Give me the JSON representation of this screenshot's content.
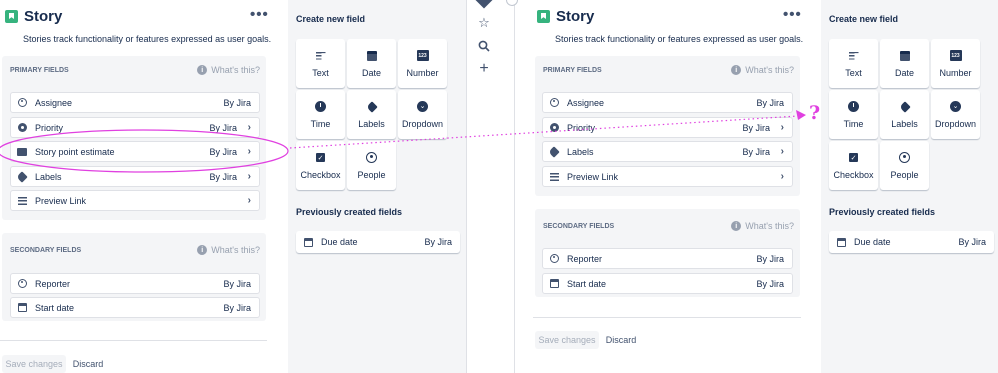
{
  "left": {
    "title": "Story",
    "more_label": "•••",
    "description": "Stories track functionality or features expressed as user goals.",
    "primary_header": "PRIMARY FIELDS",
    "whats_this": "What's this?",
    "primary_rows": [
      {
        "label": "Assignee",
        "by": "By Jira",
        "icon": "user-icon"
      },
      {
        "label": "Priority",
        "by": "By Jira",
        "icon": "priority-icon",
        "chev": "›"
      },
      {
        "label": "Story point estimate",
        "by": "By Jira",
        "icon": "number-icon",
        "chev": "›"
      },
      {
        "label": "Labels",
        "by": "By Jira",
        "icon": "label-icon",
        "chev": "›"
      },
      {
        "label": "Preview Link",
        "by": "",
        "icon": "paragraph-icon",
        "chev": "›"
      }
    ],
    "secondary_header": "SECONDARY FIELDS",
    "secondary_rows": [
      {
        "label": "Reporter",
        "by": "By Jira",
        "icon": "user-icon"
      },
      {
        "label": "Start date",
        "by": "By Jira",
        "icon": "calendar-icon"
      }
    ],
    "save": "Save changes",
    "discard": "Discard"
  },
  "create": {
    "header": "Create new field",
    "tiles": [
      "Text",
      "Date",
      "Number",
      "Time",
      "Labels",
      "Dropdown",
      "Checkbox",
      "People"
    ],
    "number_glyph": "123",
    "previous_header": "Previously created fields",
    "previous_rows": [
      {
        "label": "Due date",
        "by": "By Jira"
      }
    ]
  },
  "right": {
    "title": "Story",
    "more_label": "•••",
    "description": "Stories track functionality or features expressed as user goals.",
    "primary_header": "PRIMARY FIELDS",
    "whats_this": "What's this?",
    "primary_rows": [
      {
        "label": "Assignee",
        "by": "By Jira",
        "icon": "user-icon"
      },
      {
        "label": "Priority",
        "by": "By Jira",
        "icon": "priority-icon",
        "chev": "›"
      },
      {
        "label": "Labels",
        "by": "By Jira",
        "icon": "label-icon",
        "chev": "›"
      },
      {
        "label": "Preview Link",
        "by": "",
        "icon": "paragraph-icon",
        "chev": "›"
      }
    ],
    "secondary_header": "SECONDARY FIELDS",
    "secondary_rows": [
      {
        "label": "Reporter",
        "by": "By Jira",
        "icon": "user-icon"
      },
      {
        "label": "Start date",
        "by": "By Jira",
        "icon": "calendar-icon"
      }
    ],
    "save": "Save changes",
    "discard": "Discard"
  },
  "create2": {
    "header": "Create new field",
    "tiles": [
      "Text",
      "Date",
      "Number",
      "Time",
      "Labels",
      "Dropdown",
      "Checkbox",
      "People"
    ],
    "number_glyph": "123",
    "previous_header": "Previously created fields",
    "previous_rows": [
      {
        "label": "Due date",
        "by": "By Jira"
      }
    ]
  },
  "annotation": {
    "question_mark": "?",
    "color": "#e040e0"
  },
  "colors": {
    "story_green": "#36b37e",
    "panel_gray": "#f4f5f7",
    "text_dark": "#172b4d"
  }
}
